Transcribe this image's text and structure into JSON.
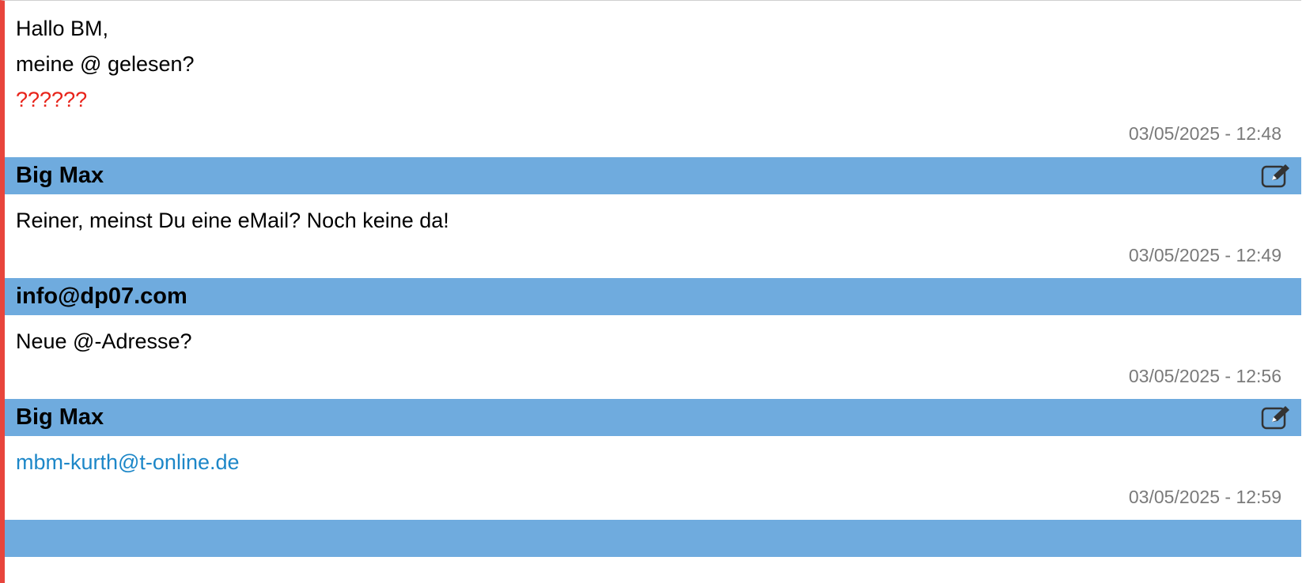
{
  "posts": [
    {
      "author": "",
      "lines": [
        "Hallo BM,",
        "meine @ gelesen?"
      ],
      "highlight": "??????",
      "timestamp": "03/05/2025 - 12:48"
    },
    {
      "author": "Big Max",
      "editable": true,
      "lines": [
        "Reiner, meinst Du eine eMail? Noch keine da!"
      ],
      "timestamp": "03/05/2025 - 12:49"
    },
    {
      "author": "info@dp07.com",
      "editable": false,
      "lines": [
        "Neue @-Adresse?"
      ],
      "timestamp": "03/05/2025 - 12:56"
    },
    {
      "author": "Big Max",
      "editable": true,
      "link": "mbm-kurth@t-online.de",
      "timestamp": "03/05/2025 - 12:59"
    }
  ],
  "icons": {
    "edit": "edit-icon"
  },
  "colors": {
    "header_bg": "#6fabde",
    "accent_border": "#e8453c",
    "highlight_text": "#e8231a",
    "link": "#1d87c8",
    "timestamp": "#7a7a7a"
  }
}
